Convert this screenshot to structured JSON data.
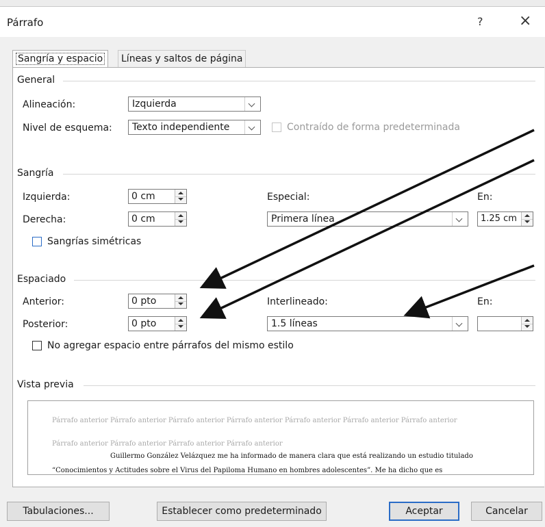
{
  "window": {
    "title": "Párrafo",
    "help": "?",
    "close": "×"
  },
  "tabs": [
    {
      "label": "Sangría y espacio",
      "active": true
    },
    {
      "label": "Líneas y saltos de página",
      "active": false
    }
  ],
  "general": {
    "header": "General",
    "alineacion_label": "Alineación:",
    "alineacion_value": "Izquierda",
    "nivel_label": "Nivel de esquema:",
    "nivel_value": "Texto independiente",
    "contraido_label": "Contraído de forma predeterminada"
  },
  "sangria": {
    "header": "Sangría",
    "izquierda_label": "Izquierda:",
    "izquierda_value": "0 cm",
    "derecha_label": "Derecha:",
    "derecha_value": "0 cm",
    "especial_label": "Especial:",
    "especial_value": "Primera línea",
    "en_label": "En:",
    "en_value": "1.25 cm",
    "simetricas_label": "Sangrías simétricas"
  },
  "espaciado": {
    "header": "Espaciado",
    "anterior_label": "Anterior:",
    "anterior_value": "0 pto",
    "posterior_label": "Posterior:",
    "posterior_value": "0 pto",
    "interlineado_label": "Interlineado:",
    "interlineado_value": "1.5 líneas",
    "en_label": "En:",
    "en_value": "",
    "no_agregar_label": "No agregar espacio entre párrafos del mismo estilo"
  },
  "preview": {
    "header": "Vista previa",
    "line1": "Párrafo anterior Párrafo anterior Párrafo anterior Párrafo anterior Párrafo anterior Párrafo anterior Párrafo anterior",
    "line2": "Párrafo anterior Párrafo anterior Párrafo anterior Párrafo anterior",
    "line3": "Guillermo González Velázquez me ha informado de manera clara que está realizando un estudio titulado",
    "line4": "“Conocimientos y Actitudes sobre el Virus del Papiloma Humano en hombres adolescentes”. Me ha dicho que es"
  },
  "buttons": {
    "tabulaciones": "Tabulaciones...",
    "predeterminado": "Establecer como predeterminado",
    "aceptar": "Aceptar",
    "cancelar": "Cancelar"
  },
  "colors": {
    "accent": "#2a6cc6",
    "arrow": "#111111"
  }
}
